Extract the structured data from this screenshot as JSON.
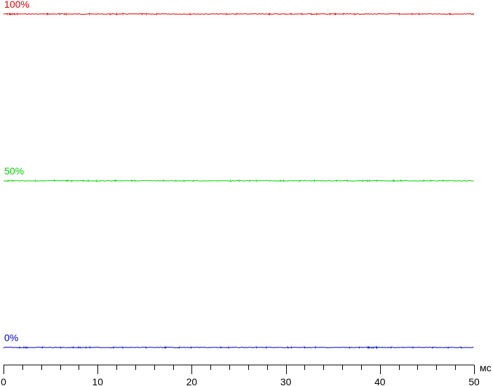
{
  "chart_data": {
    "type": "line",
    "xlabel": "мс",
    "ylabel": "",
    "title": "",
    "xlim": [
      0,
      50
    ],
    "ylim": [
      0,
      100
    ],
    "x_ticks": [
      0,
      10,
      20,
      30,
      40,
      50
    ],
    "x_tick_labels": [
      "0",
      "10",
      "20",
      "30",
      "40",
      "50"
    ],
    "minor_tick_step": 2,
    "grid": false,
    "series": [
      {
        "name": "100%",
        "color": "#e00000",
        "x": [
          0,
          50
        ],
        "y": [
          100,
          100
        ]
      },
      {
        "name": "50%",
        "color": "#00d000",
        "x": [
          0,
          50
        ],
        "y": [
          50,
          50
        ]
      },
      {
        "name": "0%",
        "color": "#0000c0",
        "x": [
          0,
          50
        ],
        "y": [
          0,
          0
        ]
      }
    ]
  }
}
